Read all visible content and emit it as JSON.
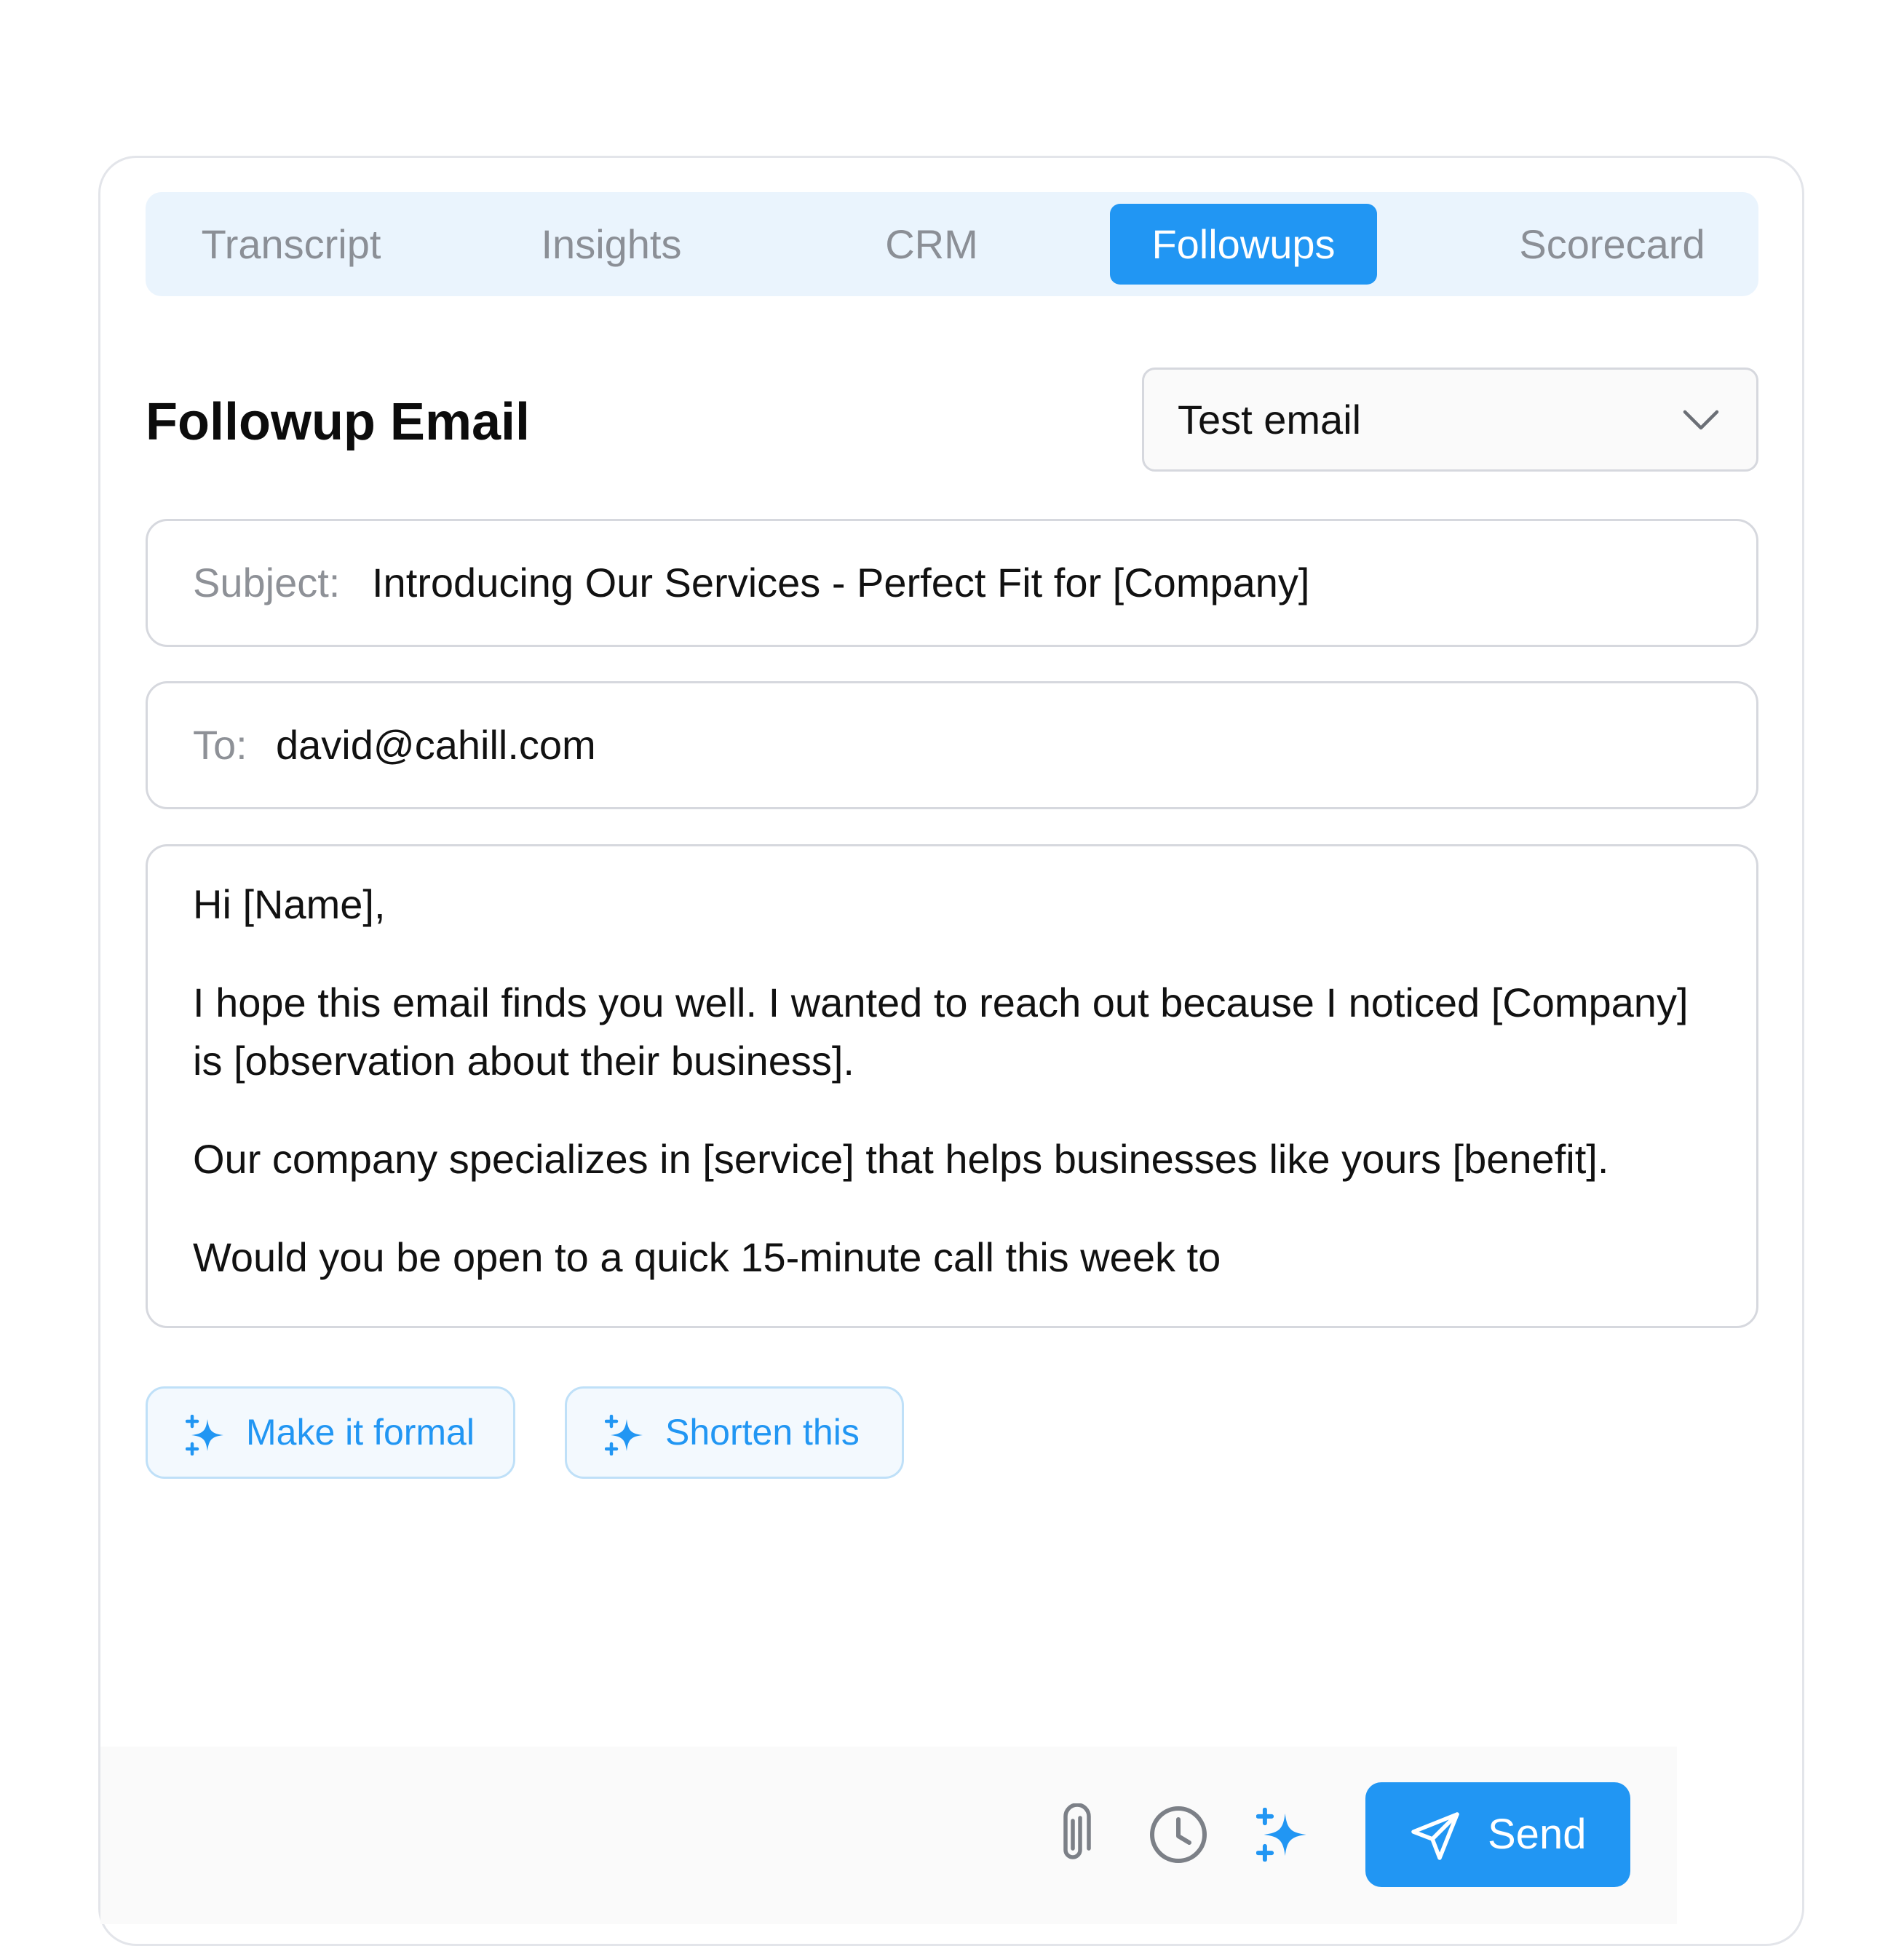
{
  "tabs": [
    {
      "label": "Transcript",
      "active": false
    },
    {
      "label": "Insights",
      "active": false
    },
    {
      "label": "CRM",
      "active": false
    },
    {
      "label": "Followups",
      "active": true
    },
    {
      "label": "Scorecard",
      "active": false
    }
  ],
  "page_title": "Followup Email",
  "template_select": {
    "value": "Test email",
    "icon": "chevron-down-icon"
  },
  "subject": {
    "label": "Subject:",
    "value": "Introducing Our Services - Perfect Fit for [Company]"
  },
  "to": {
    "label": "To:",
    "value": "david@cahill.com"
  },
  "email_body": {
    "paragraphs": [
      "Hi [Name],",
      "I hope this email finds you well. I wanted to reach out because I noticed [Company] is [observation about their business].",
      "Our company specializes in [service] that helps businesses like yours [benefit].",
      "Would you be open to a quick 15-minute call this week to"
    ]
  },
  "suggestions": [
    {
      "label": "Make it formal",
      "icon": "sparkle-icon"
    },
    {
      "label": "Shorten this",
      "icon": "sparkle-icon"
    }
  ],
  "footer": {
    "attach_icon": "paperclip-icon",
    "schedule_icon": "clock-icon",
    "ai_icon": "sparkle-icon",
    "send_label": "Send",
    "send_icon": "send-icon"
  },
  "colors": {
    "accent": "#2196f3",
    "tab_bar_bg": "#eaf4fd",
    "chip_bg": "#f3f9fe",
    "muted_text": "#8b8f96"
  }
}
